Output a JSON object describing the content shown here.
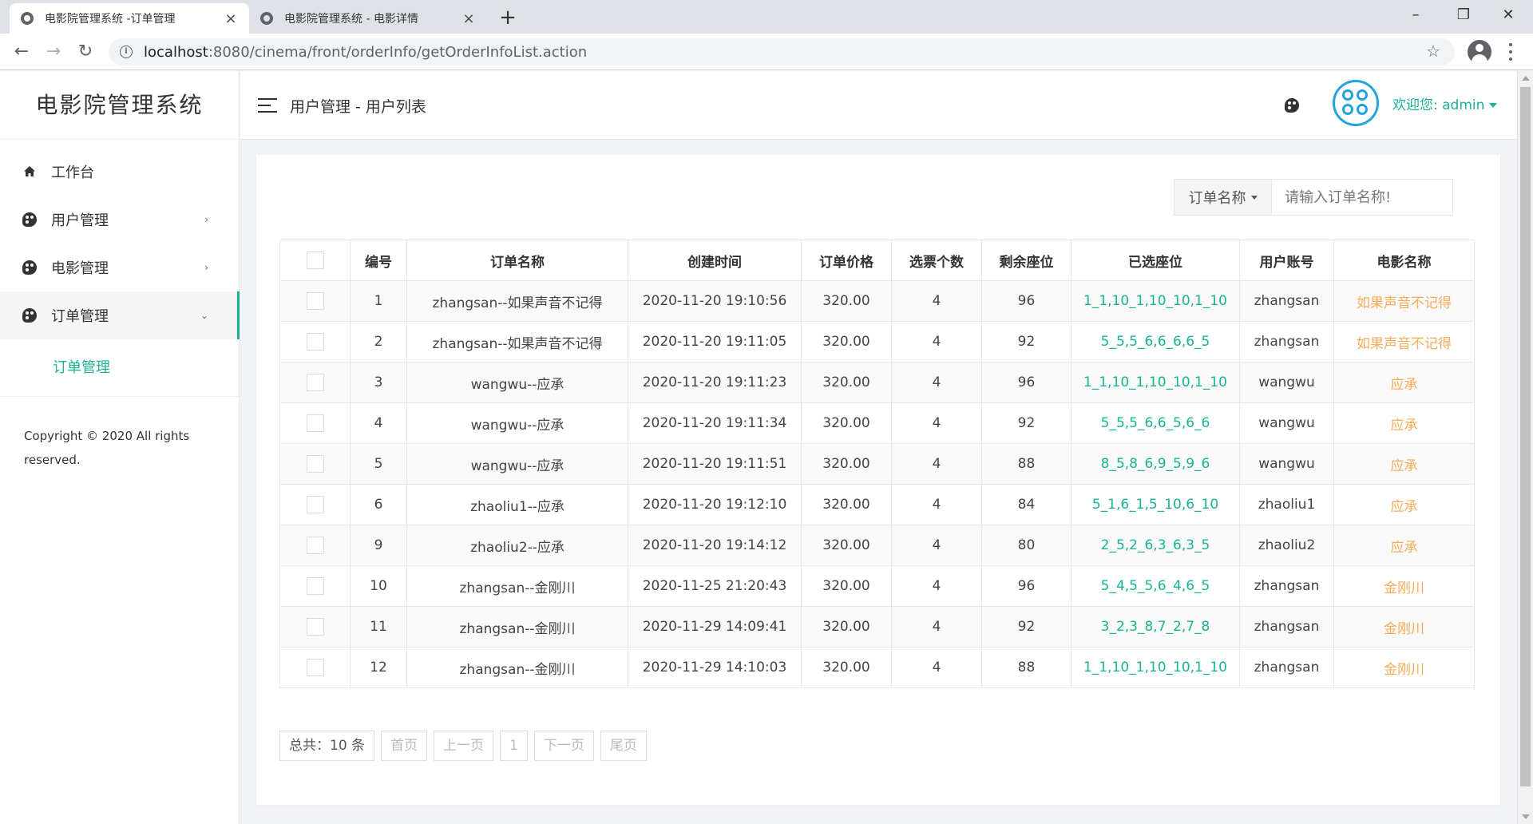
{
  "browser": {
    "tabs": [
      {
        "title": "电影院管理系统 -订单管理",
        "active": true
      },
      {
        "title": "电影院管理系统 - 电影详情",
        "active": false
      }
    ],
    "new_tab": "+",
    "url_host": "localhost",
    "url_rest": ":8080/cinema/front/orderInfo/getOrderInfoList.action",
    "window_controls": {
      "minimize": "–",
      "maximize": "❐",
      "close": "✕"
    }
  },
  "sidebar": {
    "brand": "电影院管理系统",
    "items": [
      {
        "label": "工作台",
        "icon": "home-icon"
      },
      {
        "label": "用户管理",
        "icon": "palette-icon",
        "arrow": "›"
      },
      {
        "label": "电影管理",
        "icon": "palette-icon",
        "arrow": "›"
      },
      {
        "label": "订单管理",
        "icon": "palette-icon",
        "arrow": "⌄"
      }
    ],
    "sub_item": "订单管理",
    "copyright_line1": "Copyright © 2020 All rights",
    "copyright_line2": "reserved."
  },
  "header": {
    "breadcrumb": "用户管理 - 用户列表",
    "welcome": "欢迎您:",
    "username": "admin"
  },
  "search": {
    "field_label": "订单名称",
    "placeholder": "请输入订单名称!"
  },
  "table": {
    "columns": [
      "编号",
      "订单名称",
      "创建时间",
      "订单价格",
      "选票个数",
      "剩余座位",
      "已选座位",
      "用户账号",
      "电影名称"
    ],
    "rows": [
      {
        "id": "1",
        "name": "zhangsan--如果声音不记得",
        "created": "2020-11-20 19:10:56",
        "price": "320.00",
        "count": "4",
        "remaining": "96",
        "seats": "1_1,10_1,10_10,1_10",
        "account": "zhangsan",
        "movie": "如果声音不记得"
      },
      {
        "id": "2",
        "name": "zhangsan--如果声音不记得",
        "created": "2020-11-20 19:11:05",
        "price": "320.00",
        "count": "4",
        "remaining": "92",
        "seats": "5_5,5_6,6_6,6_5",
        "account": "zhangsan",
        "movie": "如果声音不记得"
      },
      {
        "id": "3",
        "name": "wangwu--应承",
        "created": "2020-11-20 19:11:23",
        "price": "320.00",
        "count": "4",
        "remaining": "96",
        "seats": "1_1,10_1,10_10,1_10",
        "account": "wangwu",
        "movie": "应承"
      },
      {
        "id": "4",
        "name": "wangwu--应承",
        "created": "2020-11-20 19:11:34",
        "price": "320.00",
        "count": "4",
        "remaining": "92",
        "seats": "5_5,5_6,6_5,6_6",
        "account": "wangwu",
        "movie": "应承"
      },
      {
        "id": "5",
        "name": "wangwu--应承",
        "created": "2020-11-20 19:11:51",
        "price": "320.00",
        "count": "4",
        "remaining": "88",
        "seats": "8_5,8_6,9_5,9_6",
        "account": "wangwu",
        "movie": "应承"
      },
      {
        "id": "6",
        "name": "zhaoliu1--应承",
        "created": "2020-11-20 19:12:10",
        "price": "320.00",
        "count": "4",
        "remaining": "84",
        "seats": "5_1,6_1,5_10,6_10",
        "account": "zhaoliu1",
        "movie": "应承"
      },
      {
        "id": "9",
        "name": "zhaoliu2--应承",
        "created": "2020-11-20 19:14:12",
        "price": "320.00",
        "count": "4",
        "remaining": "80",
        "seats": "2_5,2_6,3_6,3_5",
        "account": "zhaoliu2",
        "movie": "应承"
      },
      {
        "id": "10",
        "name": "zhangsan--金刚川",
        "created": "2020-11-25 21:20:43",
        "price": "320.00",
        "count": "4",
        "remaining": "96",
        "seats": "5_4,5_5,6_4,6_5",
        "account": "zhangsan",
        "movie": "金刚川"
      },
      {
        "id": "11",
        "name": "zhangsan--金刚川",
        "created": "2020-11-29 14:09:41",
        "price": "320.00",
        "count": "4",
        "remaining": "92",
        "seats": "3_2,3_8,7_2,7_8",
        "account": "zhangsan",
        "movie": "金刚川"
      },
      {
        "id": "12",
        "name": "zhangsan--金刚川",
        "created": "2020-11-29 14:10:03",
        "price": "320.00",
        "count": "4",
        "remaining": "88",
        "seats": "1_1,10_1,10_10,1_10",
        "account": "zhangsan",
        "movie": "金刚川"
      }
    ]
  },
  "pager": {
    "total": "总共：10 条",
    "first": "首页",
    "prev": "上一页",
    "page": "1",
    "next": "下一页",
    "last": "尾页"
  },
  "colors": {
    "accent": "#1ab394",
    "movie_link": "#f8ac59",
    "avatar": "#23a3dd"
  }
}
